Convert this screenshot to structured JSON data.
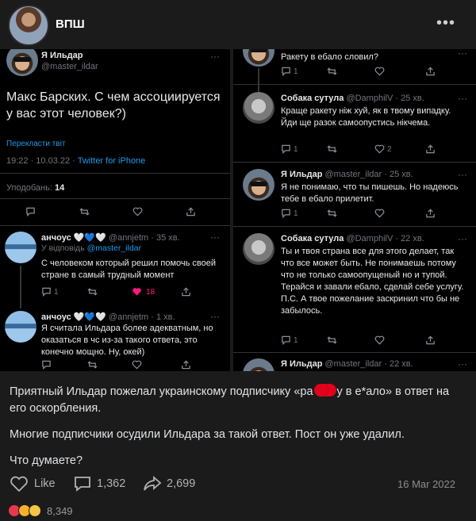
{
  "page": {
    "name": "ВПШ",
    "more": "•••"
  },
  "left": {
    "main": {
      "name": "Я Ильдар",
      "handle": "@master_ildar",
      "text": "Макс Барских. С чем ассоциируется у вас этот человек?)",
      "translate": "Перекласти твіт",
      "time": "19:22 · 10.03.22 ·",
      "client": "Twitter for iPhone",
      "likes_label": "Уподобань:",
      "likes_count": "14"
    },
    "reply1": {
      "name": "анчоус 🤍💙🤍",
      "handle": "@annjetm · 35 хв.",
      "replying_prefix": "У відповідь",
      "replying_to": "@master_ildar",
      "text": "С человеком который решил помочь своей стране в самый трудный момент",
      "reply_count": "1",
      "like_count": "18"
    },
    "reply2": {
      "name": "анчоус 🤍💙🤍",
      "handle": "@annjetm · 1 хв.",
      "text": "Я считала Ильдара более адекватным, но оказаться в чс из-за такого ответа, это конечно мощно. Ну, окей)"
    }
  },
  "right": {
    "t0": {
      "text": "Ракету в ебало словил?",
      "reply_count": "1"
    },
    "t1": {
      "name": "Собака сутула",
      "handle": "@DamphilV · 25 хв.",
      "text": "Краще ракету ніж хуй, як в твому випадку. Йди ще разок самоопустись нікчема.",
      "reply_count": "1",
      "like_count": "2"
    },
    "t2": {
      "name": "Я Ильдар",
      "handle": "@master_ildar · 25 хв.",
      "text": "Я не понимаю, что ты пишешь. Но надеюсь тебе в ебало прилетит.",
      "reply_count": "1"
    },
    "t3": {
      "name": "Собака сутула",
      "handle": "@DamphilV · 22 хв.",
      "text": "Ты и твоя страна все для этого делает, так что все может быть. Не понимаешь потому что не только самоопущеный но и тупой. Терайся и завали ебало, сделай себе услугу.\nП.С. А твое пожелание заскринил что бы не забылось.",
      "reply_count": "1"
    },
    "t4": {
      "name": "Я Ильдар",
      "handle": "@master_ildar · 22 хв."
    }
  },
  "caption": {
    "p1_before": "Приятный Ильдар пожелал украинскому подписчику «ра",
    "p1_after": "у в е*ало» в ответ на его оскорбления.",
    "p2": "Многие подписчики осудили Ильдара за такой ответ. Пост он уже удалил.",
    "p3": "Что думаете?"
  },
  "footer": {
    "like_label": "Like",
    "comments": "1,362",
    "shares": "2,699",
    "date": "16 Мar 2022",
    "reactions_count": "8,349"
  },
  "colors": {
    "twitter_blue": "#1d9bf0",
    "like_pink": "#f91880",
    "redact_red": "#e0001b"
  }
}
